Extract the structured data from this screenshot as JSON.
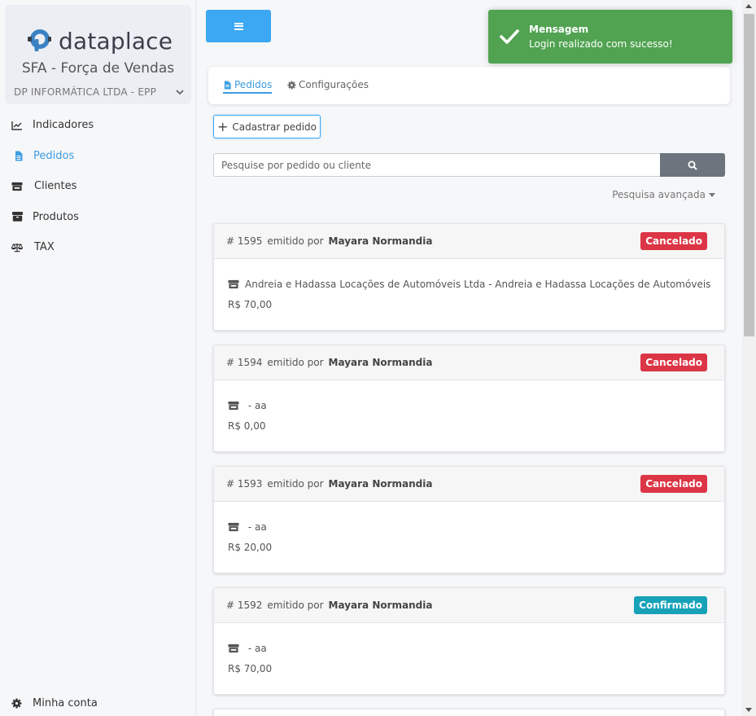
{
  "brand": {
    "logo_text": "dataplace",
    "app_name": "SFA - Força de Vendas",
    "company": "DP INFORMÁTICA LTDA - EPP"
  },
  "sidebar": {
    "items": [
      {
        "label": "Indicadores",
        "icon": "chart-line-icon"
      },
      {
        "label": "Pedidos",
        "icon": "file-text-icon"
      },
      {
        "label": "Clientes",
        "icon": "store-icon"
      },
      {
        "label": "Produtos",
        "icon": "box-icon"
      },
      {
        "label": "TAX",
        "icon": "scale-icon"
      }
    ],
    "account_label": "Minha conta"
  },
  "tabs": {
    "pedidos": "Pedidos",
    "configuracoes": "Configurações"
  },
  "actions": {
    "add_order": "Cadastrar pedido",
    "search_placeholder": "Pesquise por pedido ou cliente",
    "advanced_search": "Pesquisa avançada"
  },
  "orders": [
    {
      "number": "# 1595",
      "issued_by": "emitido por",
      "seller": "Mayara Normandia",
      "status": "Cancelado",
      "client": "Andreia e Hadassa Locações de Automóveis Ltda - Andreia e Hadassa Locações de Automóveis",
      "total": "R$ 70,00"
    },
    {
      "number": "# 1594",
      "issued_by": "emitido por",
      "seller": "Mayara Normandia",
      "status": "Cancelado",
      "client": " - aa",
      "total": "R$ 0,00"
    },
    {
      "number": "# 1593",
      "issued_by": "emitido por",
      "seller": "Mayara Normandia",
      "status": "Cancelado",
      "client": " - aa",
      "total": "R$ 20,00"
    },
    {
      "number": "# 1592",
      "issued_by": "emitido por",
      "seller": "Mayara Normandia",
      "status": "Confirmado",
      "client": " - aa",
      "total": "R$ 70,00"
    }
  ],
  "toast": {
    "title": "Mensagem",
    "message": "Login realizado com sucesso!"
  },
  "colors": {
    "primary": "#3ca7f3",
    "active_nav": "#3d9de0",
    "cancelled": "#dc3545",
    "confirmed": "#17a2b8",
    "toast": "#51a351",
    "search_button": "#6c757d"
  }
}
